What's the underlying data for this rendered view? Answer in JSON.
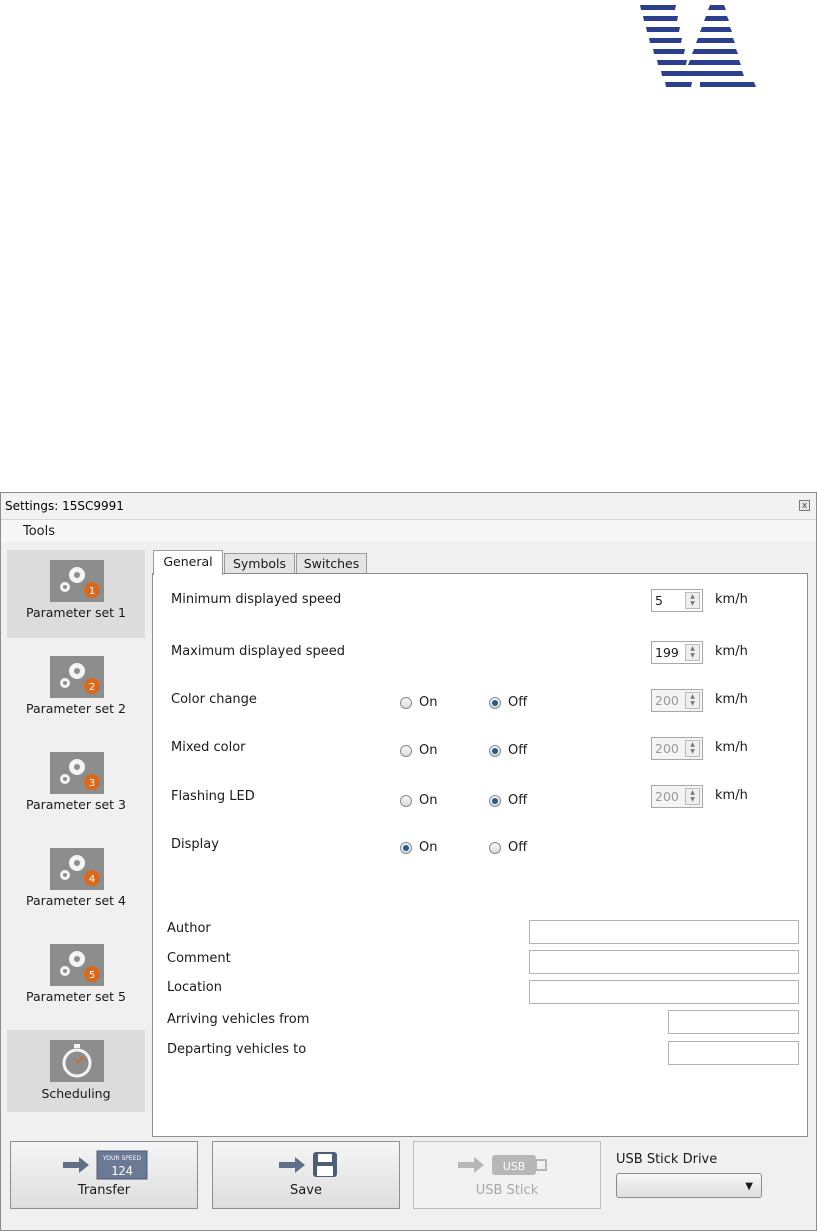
{
  "window": {
    "title": "Settings: 15SC9991",
    "close_glyph": "x"
  },
  "menu": {
    "items": [
      "Tools"
    ]
  },
  "sidebar": {
    "items": [
      {
        "label": "Parameter set 1",
        "icon": "gears-1-icon",
        "selected": true
      },
      {
        "label": "Parameter set 2",
        "icon": "gears-2-icon",
        "selected": false
      },
      {
        "label": "Parameter set 3",
        "icon": "gears-3-icon",
        "selected": false
      },
      {
        "label": "Parameter set 4",
        "icon": "gears-4-icon",
        "selected": false
      },
      {
        "label": "Parameter set 5",
        "icon": "gears-5-icon",
        "selected": false
      },
      {
        "label": "Scheduling",
        "icon": "stopwatch-icon",
        "selected": true
      }
    ],
    "badge_numbers": [
      "1",
      "2",
      "3",
      "4",
      "5"
    ]
  },
  "tabs": [
    {
      "label": "General",
      "active": true
    },
    {
      "label": "Symbols",
      "active": false
    },
    {
      "label": "Switches",
      "active": false
    }
  ],
  "general": {
    "min_speed": {
      "label": "Minimum displayed speed",
      "value": "5",
      "unit": "km/h"
    },
    "max_speed": {
      "label": "Maximum displayed speed",
      "value": "199",
      "unit": "km/h"
    },
    "color_change": {
      "label": "Color change",
      "on": "On",
      "off": "Off",
      "selected": "Off",
      "value": "200",
      "unit": "km/h"
    },
    "mixed_color": {
      "label": "Mixed color",
      "on": "On",
      "off": "Off",
      "selected": "Off",
      "value": "200",
      "unit": "km/h"
    },
    "flashing_led": {
      "label": "Flashing LED",
      "on": "On",
      "off": "Off",
      "selected": "Off",
      "value": "200",
      "unit": "km/h"
    },
    "display": {
      "label": "Display",
      "on": "On",
      "off": "Off",
      "selected": "On"
    },
    "author": {
      "label": "Author",
      "value": ""
    },
    "comment": {
      "label": "Comment",
      "value": ""
    },
    "location": {
      "label": "Location",
      "value": ""
    },
    "arriving": {
      "label": "Arriving vehicles from",
      "value": ""
    },
    "departing": {
      "label": "Departing vehicles to",
      "value": ""
    }
  },
  "buttons": {
    "transfer": {
      "label": "Transfer",
      "icon": "transfer-display-icon",
      "display_text": "YOUR SPEED",
      "display_number": "124"
    },
    "save": {
      "label": "Save",
      "icon": "floppy-disk-icon"
    },
    "usb_stick": {
      "label": "USB Stick",
      "icon": "usb-stick-icon",
      "icon_text": "USB",
      "enabled": false
    }
  },
  "usb_drive": {
    "label": "USB Stick Drive",
    "selected": ""
  },
  "colors": {
    "logo_blue": "#2b3f8e",
    "badge_orange": "#d8691d",
    "accent_radio": "#2a5a8e"
  }
}
